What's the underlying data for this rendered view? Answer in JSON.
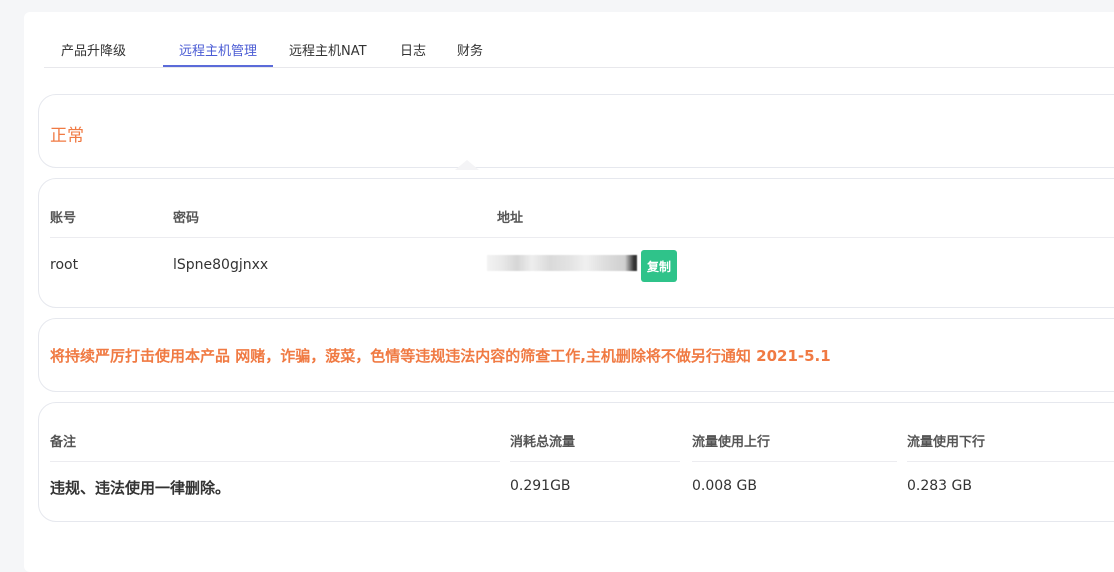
{
  "tabs": [
    {
      "label": "产品升降级"
    },
    {
      "label": "远程主机管理"
    },
    {
      "label": "远程主机NAT"
    },
    {
      "label": "日志"
    },
    {
      "label": "财务"
    }
  ],
  "status": {
    "text": "正常",
    "color": "#f07a43"
  },
  "credentials": {
    "headers": {
      "account": "账号",
      "password": "密码",
      "address": "地址"
    },
    "account": "root",
    "password": "lSpne80gjnxx",
    "copy_label": "复制"
  },
  "notice": {
    "text": "将持续严厉打击使用本产品 网赌，诈骗，菠菜，色情等违规违法内容的筛查工作,主机删除将不做另行通知 2021-5.1"
  },
  "usage": {
    "headers": {
      "remark": "备注",
      "total": "消耗总流量",
      "upload": "流量使用上行",
      "download": "流量使用下行"
    },
    "remark": "违规、违法使用一律删除。",
    "total": "0.291GB",
    "upload": "0.008 GB",
    "download": "0.283 GB"
  },
  "colors": {
    "accent": "#5b6bd9",
    "warning": "#f07a43",
    "copy_button": "#2fc38a"
  }
}
